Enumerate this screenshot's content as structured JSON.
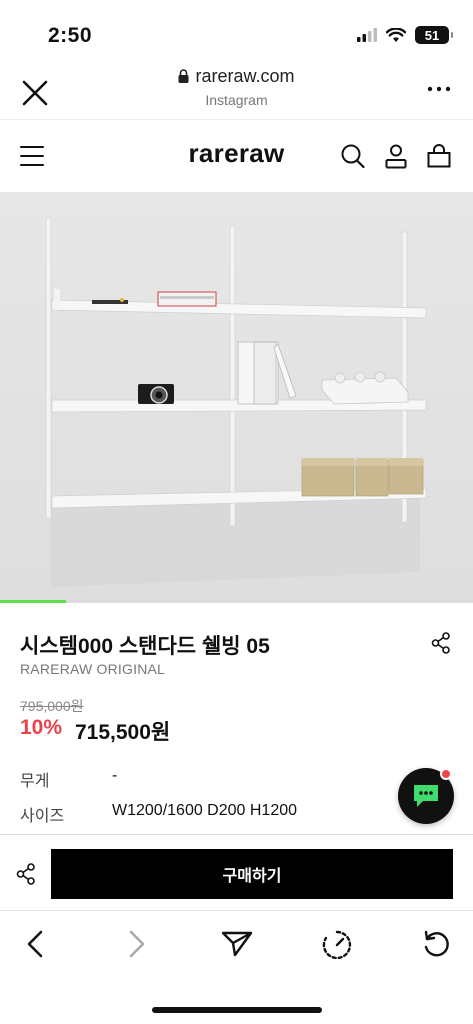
{
  "status": {
    "time": "2:50",
    "battery": "51"
  },
  "browser": {
    "url": "rareraw.com",
    "source": "Instagram"
  },
  "site": {
    "brand": "rareraw"
  },
  "hero": {
    "progress_fraction": 0.14
  },
  "product": {
    "title": "시스템000 스탠다드 쉘빙 05",
    "brand": "RARERAW ORIGINAL",
    "original_price": "795,000원",
    "discount": "10%",
    "sale_price": "715,500원",
    "specs": [
      {
        "label": "무게",
        "value": "-"
      },
      {
        "label": "사이즈",
        "value": "W1200/1600 D200 H1200"
      }
    ]
  },
  "actions": {
    "buy_label": "구매하기"
  },
  "icons": {
    "close": "close-icon",
    "more": "more-icon",
    "menu": "menu-icon",
    "search": "search-icon",
    "account": "account-icon",
    "cart": "bag-icon",
    "share": "share-icon",
    "chat": "chat-icon",
    "back": "back-icon",
    "forward": "forward-icon",
    "send": "send-icon",
    "clock": "timer-icon",
    "reload": "reload-icon"
  },
  "colors": {
    "accent_red": "#e8434a",
    "progress_green": "#5ee04a",
    "buy_button": "#000000",
    "chat_badge": "#f0464c",
    "chat_glyph": "#3ddc6c"
  }
}
